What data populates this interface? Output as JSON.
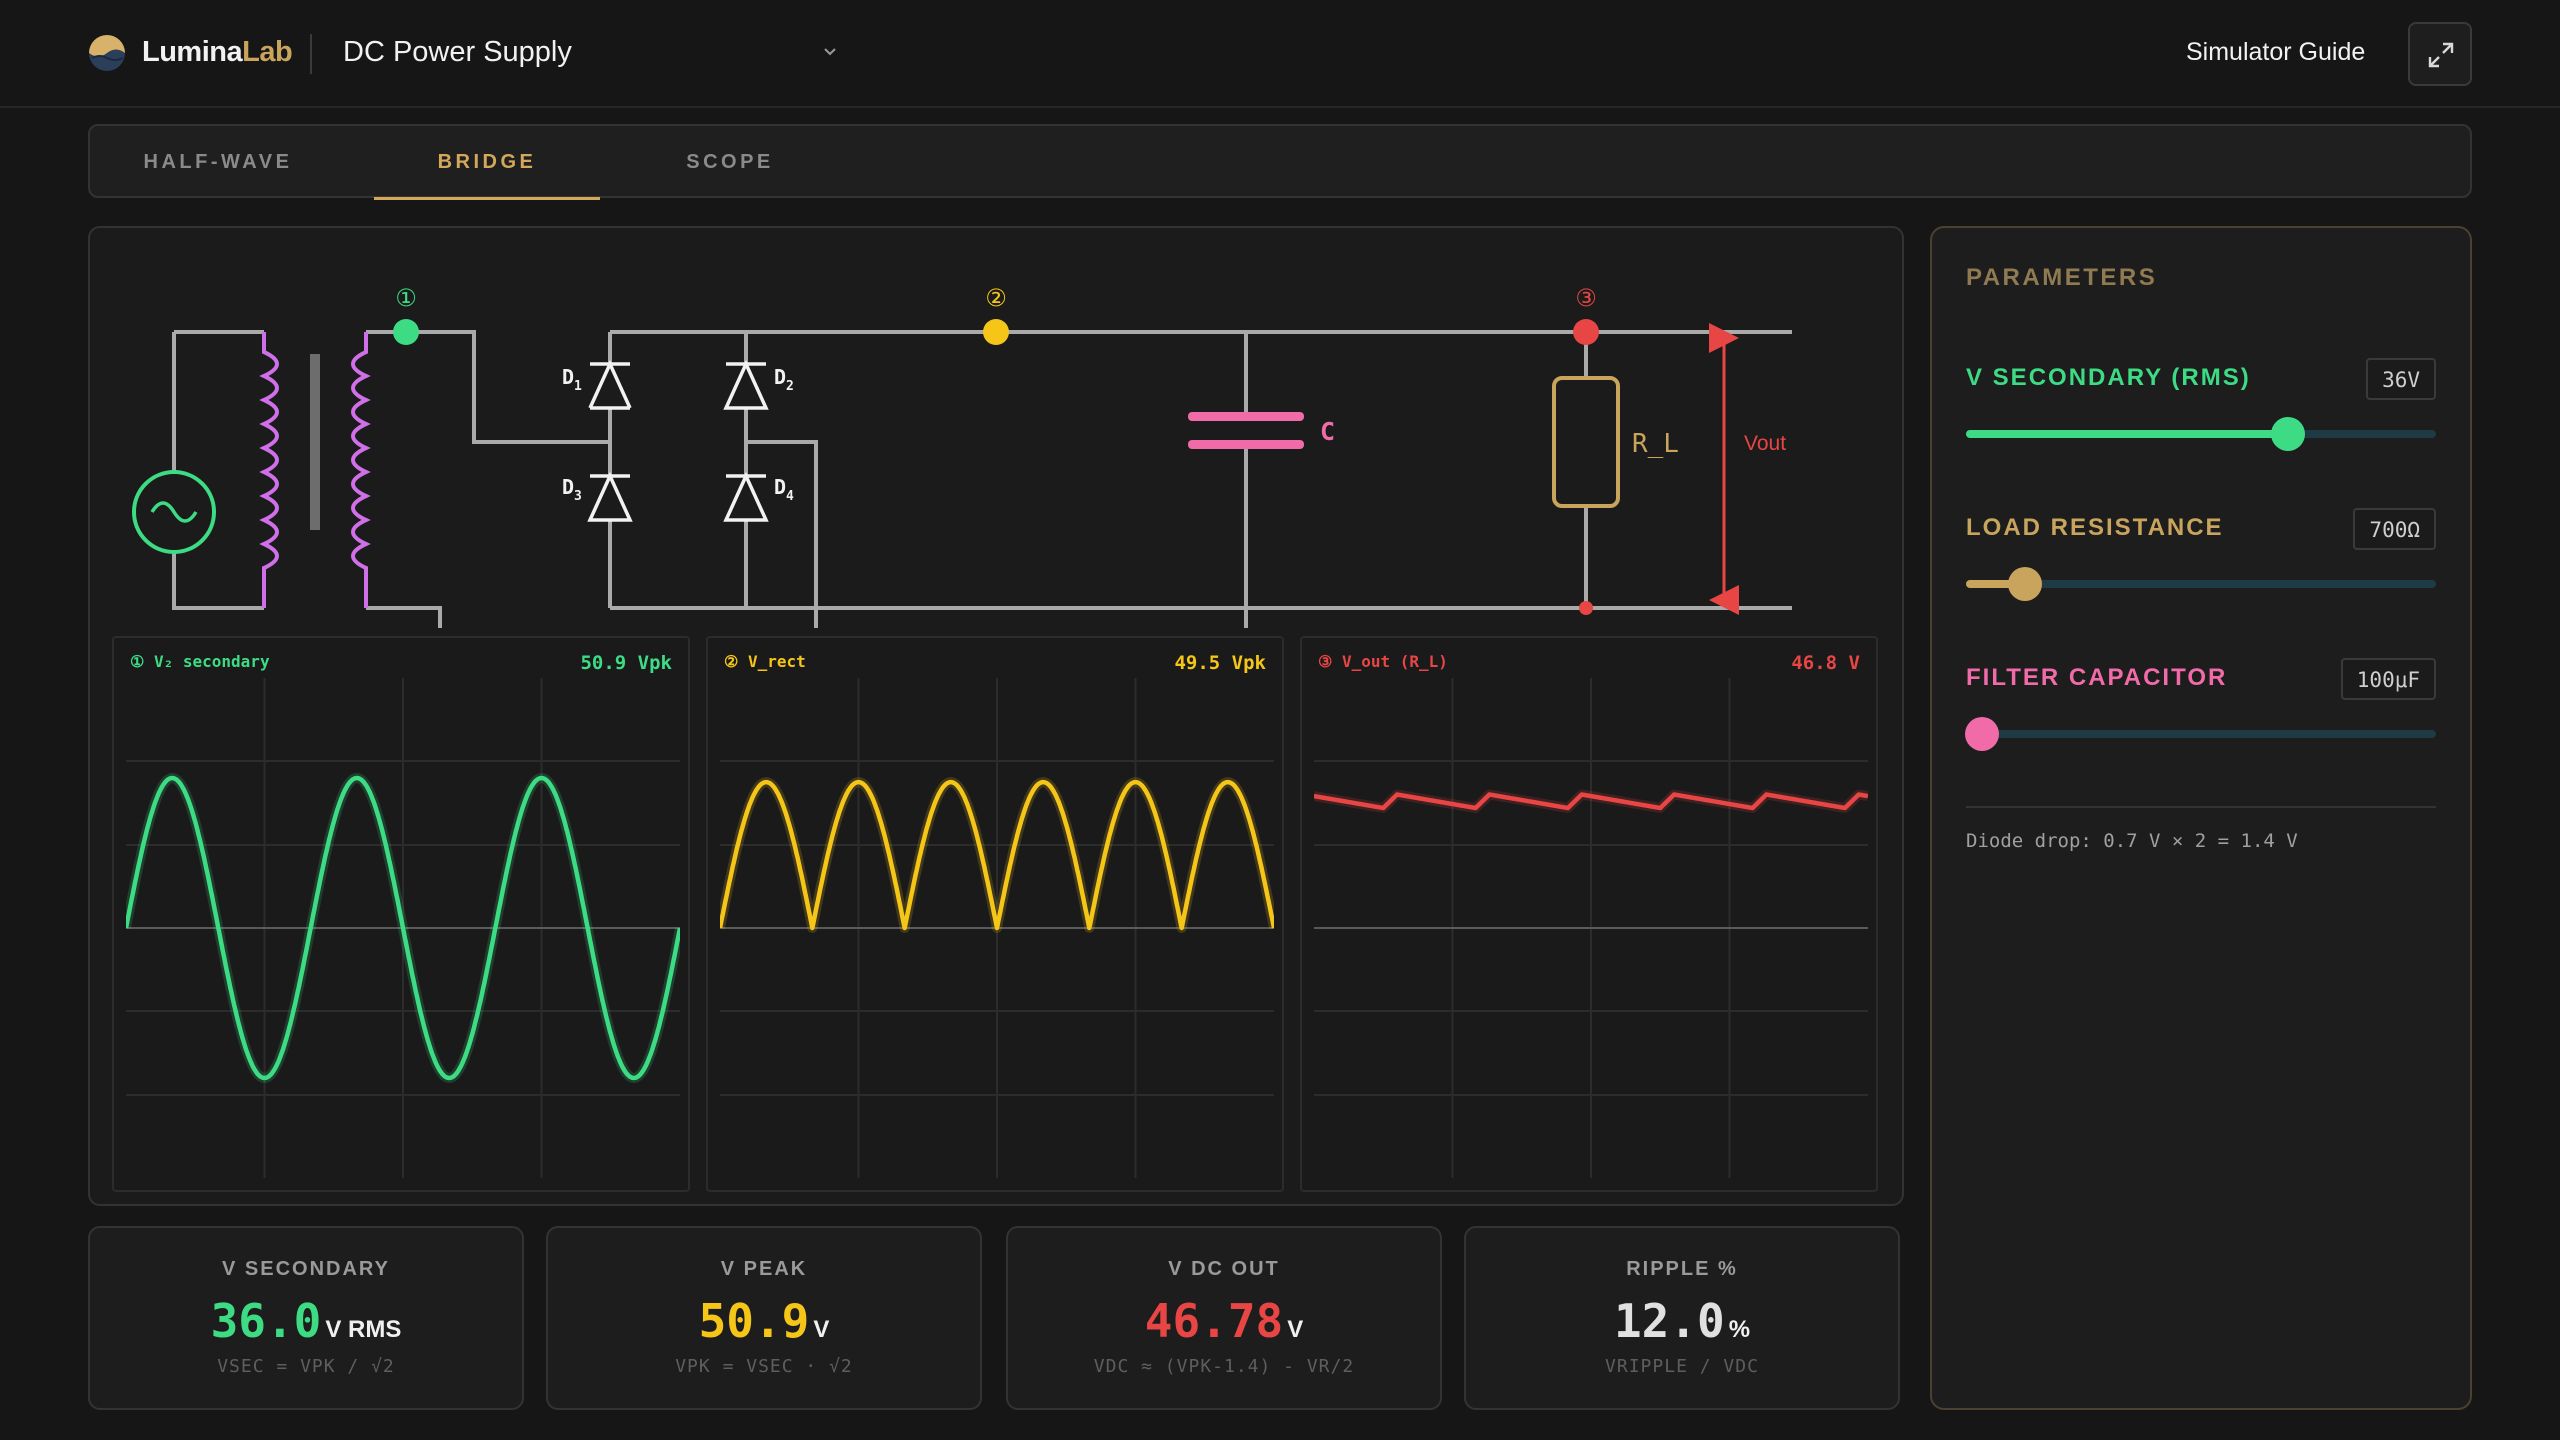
{
  "header": {
    "brand_part1": "Lumina",
    "brand_part2": "Lab",
    "title": "DC Power Supply",
    "guide_label": "Simulator Guide",
    "icons": {
      "logo": "lumina-logo-icon",
      "dropdown": "chevron-down-icon",
      "expand": "expand-icon"
    }
  },
  "tabs": [
    {
      "label": "HALF-WAVE",
      "active": false
    },
    {
      "label": "BRIDGE",
      "active": true
    },
    {
      "label": "SCOPE",
      "active": false
    }
  ],
  "circuit": {
    "nodes": [
      "①",
      "②",
      "③"
    ],
    "diodes": [
      "D",
      "D",
      "D",
      "D"
    ],
    "diode_subscripts": [
      "1",
      "2",
      "3",
      "4"
    ],
    "capacitor_label": "C",
    "resistor_label": "R_L",
    "output_label": "Vout"
  },
  "scopes": [
    {
      "label": "① V₂ secondary",
      "value": "50.9 Vpk",
      "color": "#3ddc84",
      "waveform": "sine",
      "peak_v": 50.9
    },
    {
      "label": "② V_rect",
      "value": "49.5 Vpk",
      "color": "#f5c518",
      "waveform": "full-wave-rectified",
      "peak_v": 49.5
    },
    {
      "label": "③ V_out (R_L)",
      "value": "46.8 V",
      "color": "#e84545",
      "waveform": "dc-with-ripple",
      "peak_v": 46.8
    }
  ],
  "stats": [
    {
      "title": "V SECONDARY",
      "value": "36.0",
      "unit": "V RMS",
      "formula": "VSEC = VPK / √2",
      "color": "#3ddc84"
    },
    {
      "title": "V PEAK",
      "value": "50.9",
      "unit": "V",
      "formula": "VPK = VSEC · √2",
      "color": "#f5c518"
    },
    {
      "title": "V DC OUT",
      "value": "46.78",
      "unit": "V",
      "formula": "VDC ≈ (VPK-1.4) - VR/2",
      "color": "#e84545"
    },
    {
      "title": "RIPPLE %",
      "value": "12.0",
      "unit": "%",
      "formula": "VRIPPLE / VDC",
      "color": "#e0e0e0"
    }
  ],
  "params": {
    "title": "PARAMETERS",
    "sliders": [
      {
        "label": "V SECONDARY (RMS)",
        "value": "36V",
        "fraction": 0.685,
        "color": "#3ddc84",
        "thumb": "#3ddc84"
      },
      {
        "label": "LOAD RESISTANCE",
        "value": "700Ω",
        "fraction": 0.125,
        "color": "#c9a45c",
        "thumb": "#c9a45c"
      },
      {
        "label": "FILTER CAPACITOR",
        "value": "100μF",
        "fraction": 0.035,
        "color": "#f06ba8",
        "thumb": "#f06ba8"
      }
    ],
    "note": "Diode drop: 0.7 V × 2 = 1.4 V"
  }
}
